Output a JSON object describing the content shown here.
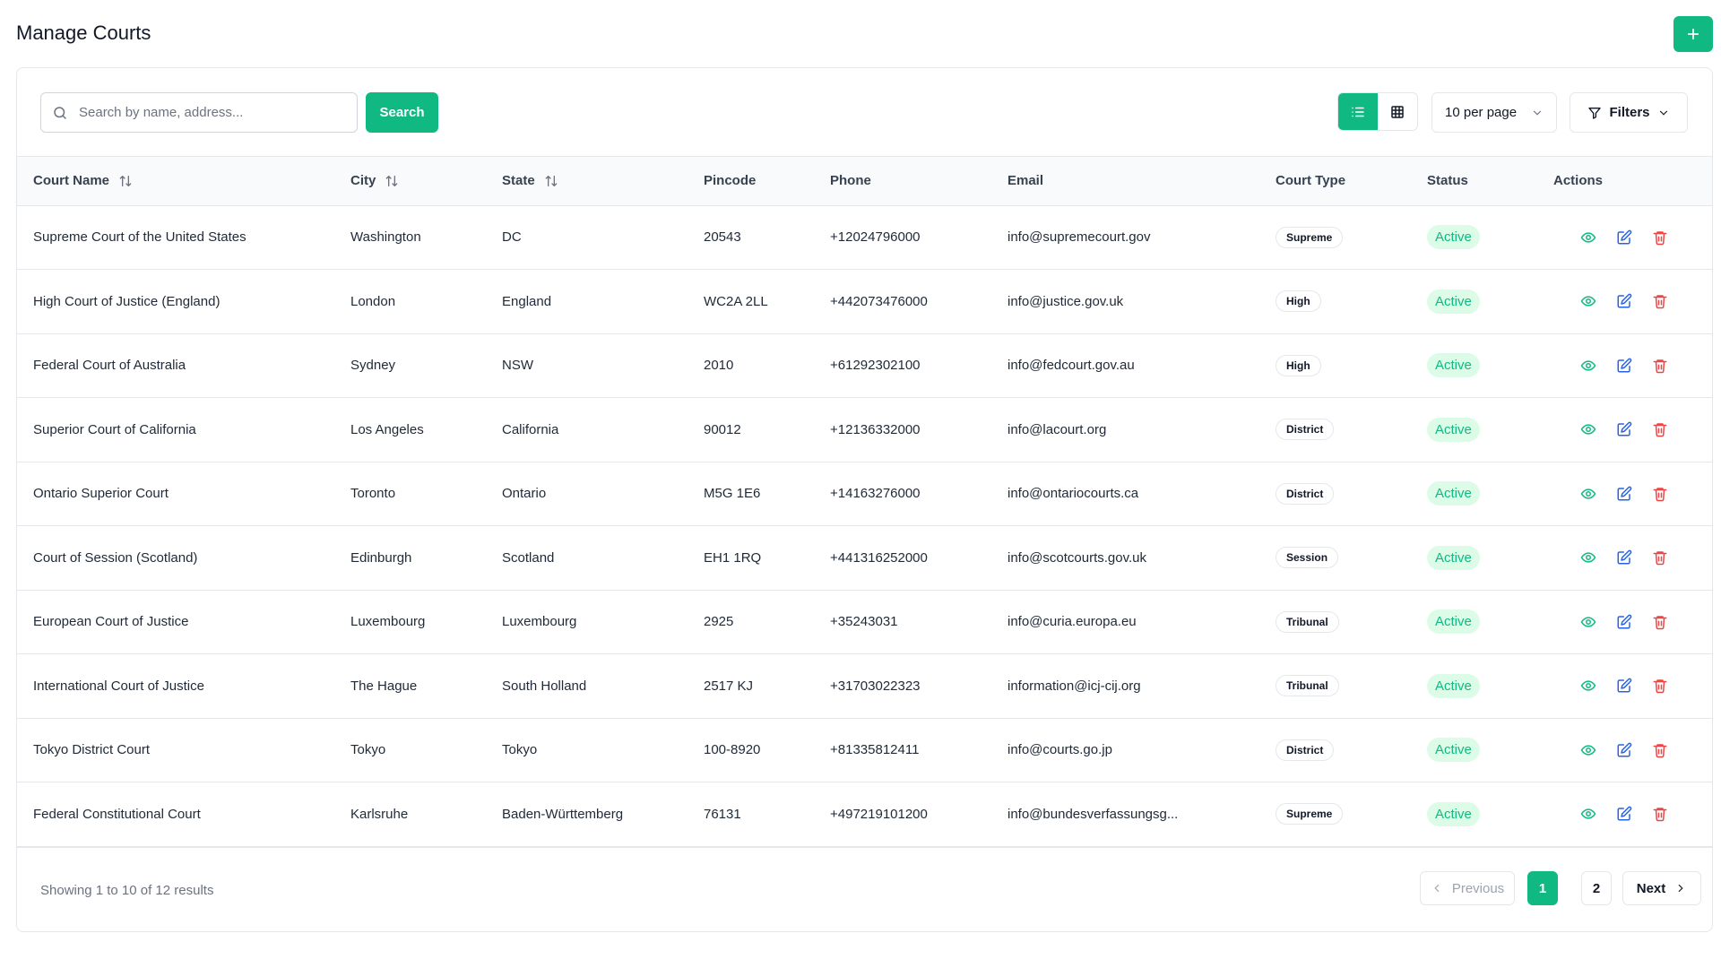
{
  "header": {
    "title": "Manage Courts"
  },
  "toolbar": {
    "search_placeholder": "Search by name, address...",
    "search_label": "Search",
    "per_page": "10 per page",
    "filters_label": "Filters"
  },
  "colors": {
    "accent": "#10b981",
    "danger": "#ef4444",
    "status_bg": "#dcfce7"
  },
  "table": {
    "columns": [
      "Court Name",
      "City",
      "State",
      "Pincode",
      "Phone",
      "Email",
      "Court Type",
      "Status",
      "Actions"
    ],
    "rows": [
      {
        "name": "Supreme Court of the United States",
        "city": "Washington",
        "state": "DC",
        "pincode": "20543",
        "phone": "+12024796000",
        "email": "info@supremecourt.gov",
        "type": "Supreme",
        "status": "Active"
      },
      {
        "name": "High Court of Justice (England)",
        "city": "London",
        "state": "England",
        "pincode": "WC2A 2LL",
        "phone": "+442073476000",
        "email": "info@justice.gov.uk",
        "type": "High",
        "status": "Active"
      },
      {
        "name": "Federal Court of Australia",
        "city": "Sydney",
        "state": "NSW",
        "pincode": "2010",
        "phone": "+61292302100",
        "email": "info@fedcourt.gov.au",
        "type": "High",
        "status": "Active"
      },
      {
        "name": "Superior Court of California",
        "city": "Los Angeles",
        "state": "California",
        "pincode": "90012",
        "phone": "+12136332000",
        "email": "info@lacourt.org",
        "type": "District",
        "status": "Active"
      },
      {
        "name": "Ontario Superior Court",
        "city": "Toronto",
        "state": "Ontario",
        "pincode": "M5G 1E6",
        "phone": "+14163276000",
        "email": "info@ontariocourts.ca",
        "type": "District",
        "status": "Active"
      },
      {
        "name": "Court of Session (Scotland)",
        "city": "Edinburgh",
        "state": "Scotland",
        "pincode": "EH1 1RQ",
        "phone": "+441316252000",
        "email": "info@scotcourts.gov.uk",
        "type": "Session",
        "status": "Active"
      },
      {
        "name": "European Court of Justice",
        "city": "Luxembourg",
        "state": "Luxembourg",
        "pincode": "2925",
        "phone": "+35243031",
        "email": "info@curia.europa.eu",
        "type": "Tribunal",
        "status": "Active"
      },
      {
        "name": "International Court of Justice",
        "city": "The Hague",
        "state": "South Holland",
        "pincode": "2517 KJ",
        "phone": "+31703022323",
        "email": "information@icj-cij.org",
        "type": "Tribunal",
        "status": "Active"
      },
      {
        "name": "Tokyo District Court",
        "city": "Tokyo",
        "state": "Tokyo",
        "pincode": "100-8920",
        "phone": "+81335812411",
        "email": "info@courts.go.jp",
        "type": "District",
        "status": "Active"
      },
      {
        "name": "Federal Constitutional Court",
        "city": "Karlsruhe",
        "state": "Baden-Württemberg",
        "pincode": "76131",
        "phone": "+497219101200",
        "email": "info@bundesverfassungsg...",
        "type": "Supreme",
        "status": "Active"
      }
    ]
  },
  "pagination": {
    "summary": "Showing 1 to 10 of 12 results",
    "previous": "Previous",
    "next": "Next",
    "pages": [
      "1",
      "2"
    ],
    "current": "1"
  }
}
